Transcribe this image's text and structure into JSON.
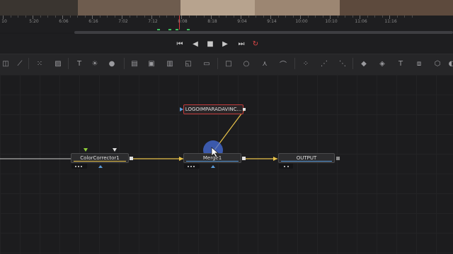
{
  "ruler": {
    "labels": [
      "10",
      "5:20",
      "6:06",
      "6:16",
      "7:02",
      "7:12",
      "8:08",
      "8:18",
      "9:04",
      "9:14",
      "10:00",
      "10:10",
      "11:06",
      "11:16"
    ]
  },
  "transport": {
    "buttons": [
      {
        "name": "go-to-start-icon",
        "glyph": "⏮"
      },
      {
        "name": "step-back-icon",
        "glyph": "◀"
      },
      {
        "name": "stop-icon",
        "glyph": "■"
      },
      {
        "name": "play-icon",
        "glyph": "▶"
      },
      {
        "name": "go-to-end-icon",
        "glyph": "⏭"
      },
      {
        "name": "loop-icon",
        "glyph": "↻"
      }
    ]
  },
  "toolbar": {
    "tools": [
      {
        "name": "paint-icon",
        "glyph": "◫"
      },
      {
        "name": "brush-icon",
        "glyph": "⟋"
      },
      {
        "name": "particles-icon",
        "glyph": "⁙"
      },
      {
        "name": "gradient-icon",
        "glyph": "▨"
      },
      {
        "name": "text-tool-icon",
        "glyph": "T"
      },
      {
        "name": "brightness-icon",
        "glyph": "☀"
      },
      {
        "name": "color-drop-icon",
        "glyph": "●"
      },
      {
        "name": "merge-tool-icon",
        "glyph": "▤"
      },
      {
        "name": "background-icon",
        "glyph": "▣"
      },
      {
        "name": "media-in-icon",
        "glyph": "▥"
      },
      {
        "name": "transform-icon",
        "glyph": "◱"
      },
      {
        "name": "media-out-icon",
        "glyph": "▭"
      },
      {
        "name": "rectangle-mask-icon",
        "glyph": "□"
      },
      {
        "name": "ellipse-mask-icon",
        "glyph": "○"
      },
      {
        "name": "polygon-mask-icon",
        "glyph": "⋏"
      },
      {
        "name": "bspline-mask-icon",
        "glyph": "⌒"
      },
      {
        "name": "particle-emitter-icon",
        "glyph": "⁘"
      },
      {
        "name": "particle-render-icon",
        "glyph": "⋰"
      },
      {
        "name": "particle-style-icon",
        "glyph": "⋱"
      },
      {
        "name": "shape3d-icon",
        "glyph": "◆"
      },
      {
        "name": "merge3d-icon",
        "glyph": "◈"
      },
      {
        "name": "text3d-icon",
        "glyph": "T"
      },
      {
        "name": "camera3d-icon",
        "glyph": "⧈"
      },
      {
        "name": "render3d-icon",
        "glyph": "⬡"
      },
      {
        "name": "light3d-icon",
        "glyph": "◐"
      }
    ]
  },
  "nodes": {
    "logo": {
      "label": "LOGOIMPARADAVINC..."
    },
    "color_corrector": {
      "label": "ColorCorrector1"
    },
    "merge": {
      "label": "Merge1"
    },
    "output": {
      "label": "OUTPUT"
    }
  },
  "colors": {
    "accent_blue": "#5a9ad8",
    "link_yellow": "#e8c24a",
    "selected_red": "#c23a3a",
    "playhead_red": "#d43b3b"
  }
}
